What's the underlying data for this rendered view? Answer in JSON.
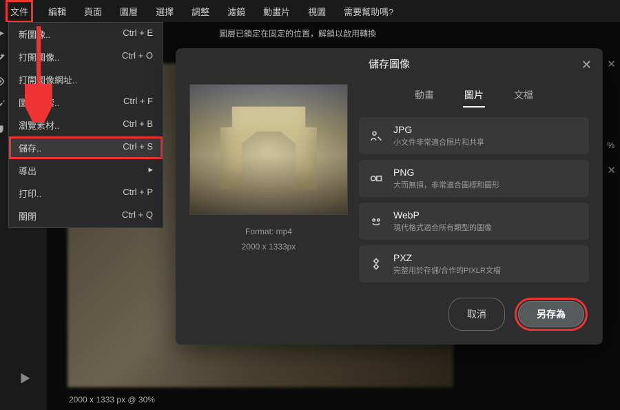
{
  "menubar": [
    "文件",
    "編輯",
    "頁面",
    "圖層",
    "選擇",
    "調整",
    "濾鏡",
    "動畫片",
    "視圖",
    "需要幫助嗎?"
  ],
  "dropdown": [
    {
      "label": "新圖像..",
      "shortcut": "Ctrl + E"
    },
    {
      "label": "打開圖像..",
      "shortcut": "Ctrl + O"
    },
    {
      "label": "打開圖像網址..",
      "shortcut": ""
    },
    {
      "label": "圖片搜索..",
      "shortcut": "Ctrl + F"
    },
    {
      "label": "瀏覽素材..",
      "shortcut": "Ctrl + B"
    },
    {
      "label": "儲存..",
      "shortcut": "Ctrl + S"
    },
    {
      "label": "導出",
      "shortcut": "▸"
    },
    {
      "label": "打印..",
      "shortcut": "Ctrl + P"
    },
    {
      "label": "關閉",
      "shortcut": "Ctrl + Q"
    }
  ],
  "lock_msg": "圖層已鎖定在固定的位置，解鎖以啟用轉換",
  "dialog": {
    "title": "儲存圖像",
    "tabs": [
      "動畫",
      "圖片",
      "文檔"
    ],
    "active_tab": 1,
    "preview": {
      "format_line": "Format: mp4",
      "dims": "2000 x 1333px"
    },
    "formats": [
      {
        "name": "JPG",
        "desc": "小文件非常適合照片和共享"
      },
      {
        "name": "PNG",
        "desc": "大而無損，非常適合圖標和圖形"
      },
      {
        "name": "WebP",
        "desc": "現代格式適合所有類型的圖像"
      },
      {
        "name": "PXZ",
        "desc": "完整用於存儲/合作的PIXLR文檔"
      }
    ],
    "cancel": "取消",
    "save_as": "另存為"
  },
  "status": "2000 x 1333 px @ 30%",
  "pct": "%"
}
